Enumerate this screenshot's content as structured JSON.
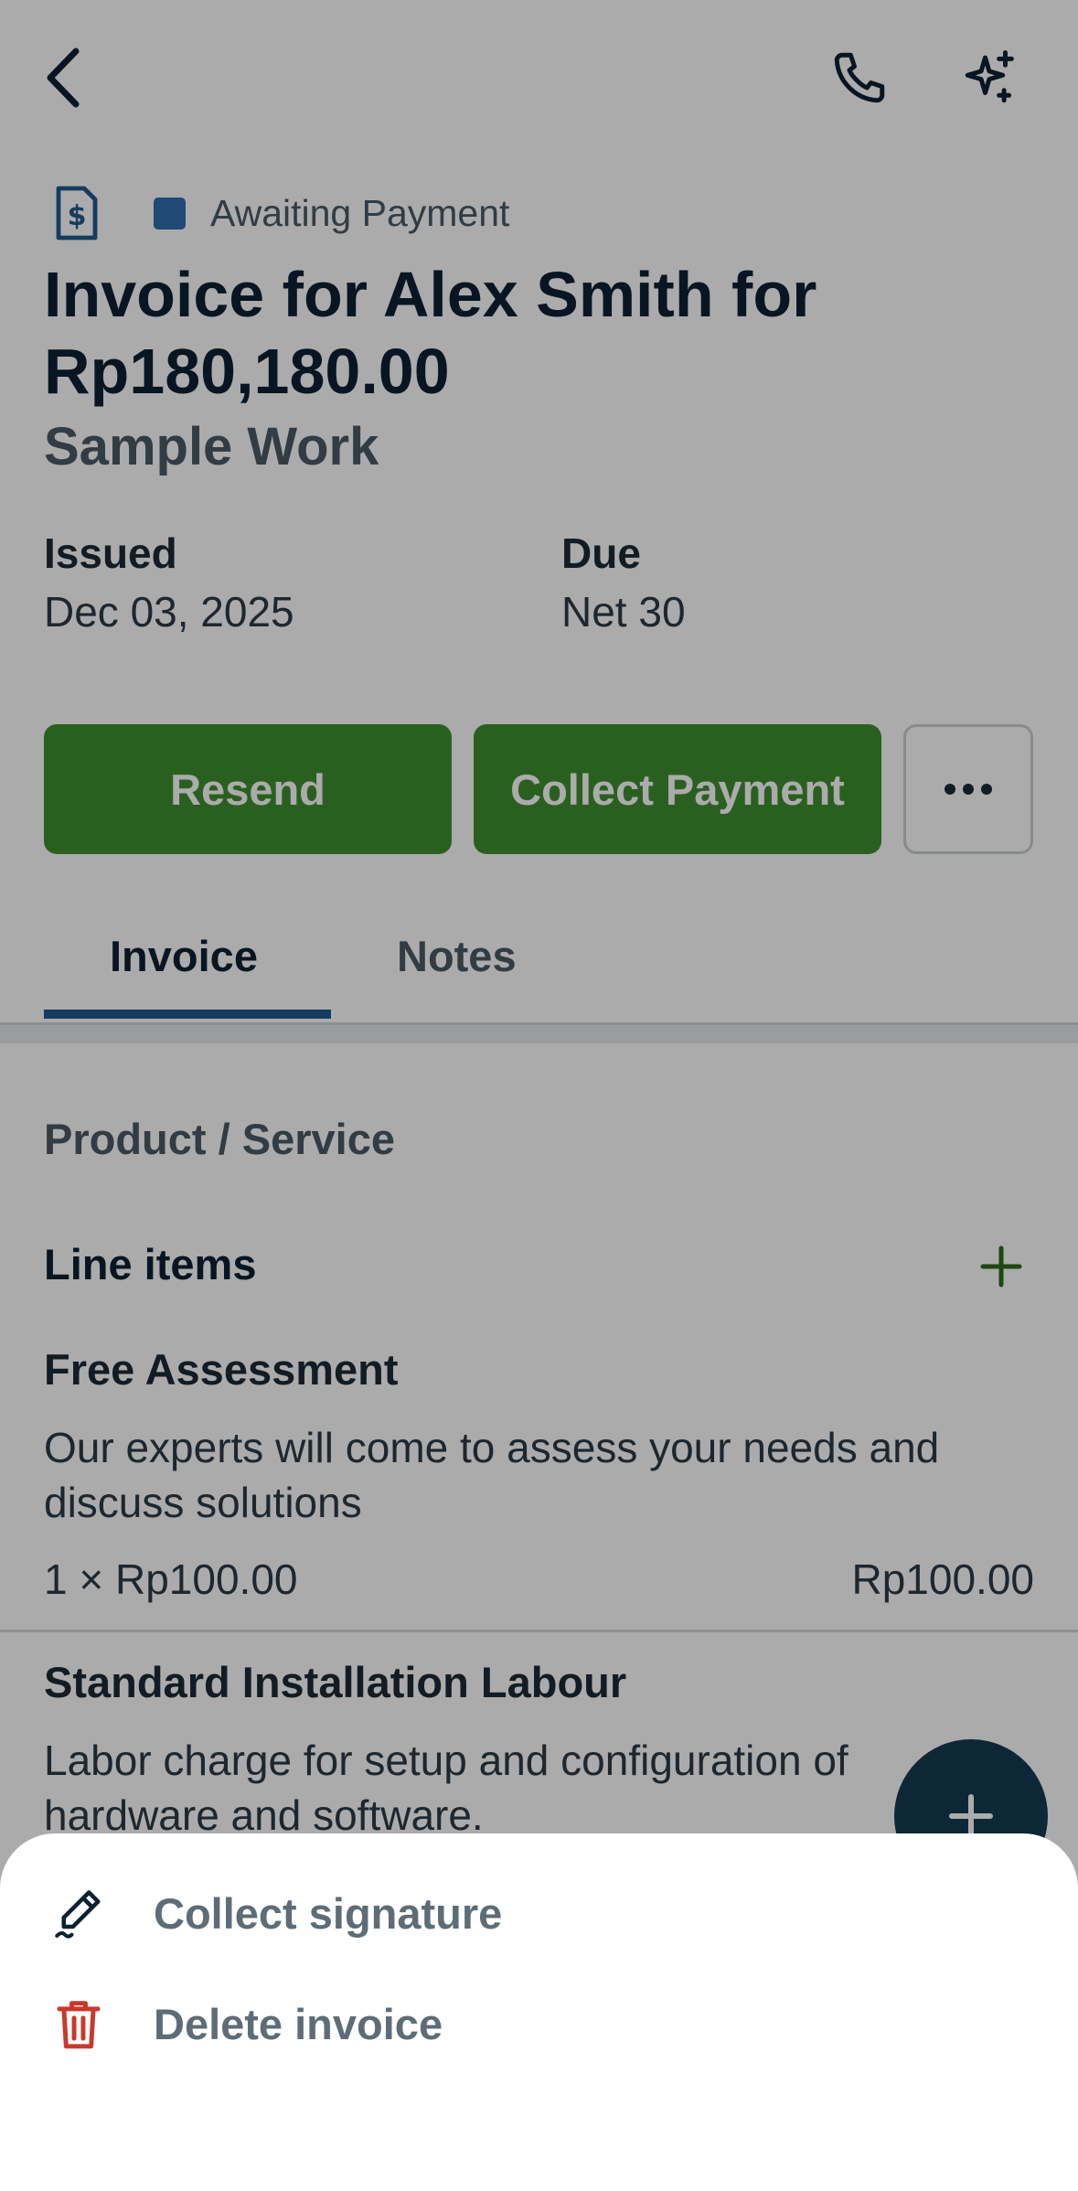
{
  "header": {
    "back_icon": "chevron-left-icon",
    "phone_icon": "phone-icon",
    "ai_icon": "sparkles-icon"
  },
  "invoice": {
    "doc_icon": "invoice-dollar-icon",
    "status": "Awaiting Payment",
    "status_color": "#2f6fb0",
    "title": "Invoice for Alex Smith for Rp180,180.00",
    "subtitle": "Sample Work",
    "issued_label": "Issued",
    "issued_value": "Dec 03, 2025",
    "due_label": "Due",
    "due_value": "Net 30"
  },
  "actions": {
    "resend_label": "Resend",
    "collect_label": "Collect Payment",
    "more_icon": "more-horizontal-icon",
    "accent_color": "#2d6a1a"
  },
  "tabs": [
    {
      "label": "Invoice",
      "active": true
    },
    {
      "label": "Notes",
      "active": false
    }
  ],
  "content": {
    "section_title": "Product / Service",
    "line_items_label": "Line items",
    "add_icon": "plus-icon",
    "items": [
      {
        "name": "Free Assessment",
        "description": "Our experts will come to assess your needs and discuss solutions",
        "qty": "1 × Rp100.00",
        "total": "Rp100.00"
      },
      {
        "name": "Standard Installation Labour",
        "description": "Labor charge for setup and configuration of hardware and software."
      }
    ]
  },
  "fab": {
    "icon": "plus-icon"
  },
  "sheet": {
    "items": [
      {
        "label": "Collect signature",
        "icon": "pen-signature-icon"
      },
      {
        "label": "Delete invoice",
        "icon": "trash-icon",
        "icon_color": "#c9392b"
      }
    ]
  }
}
